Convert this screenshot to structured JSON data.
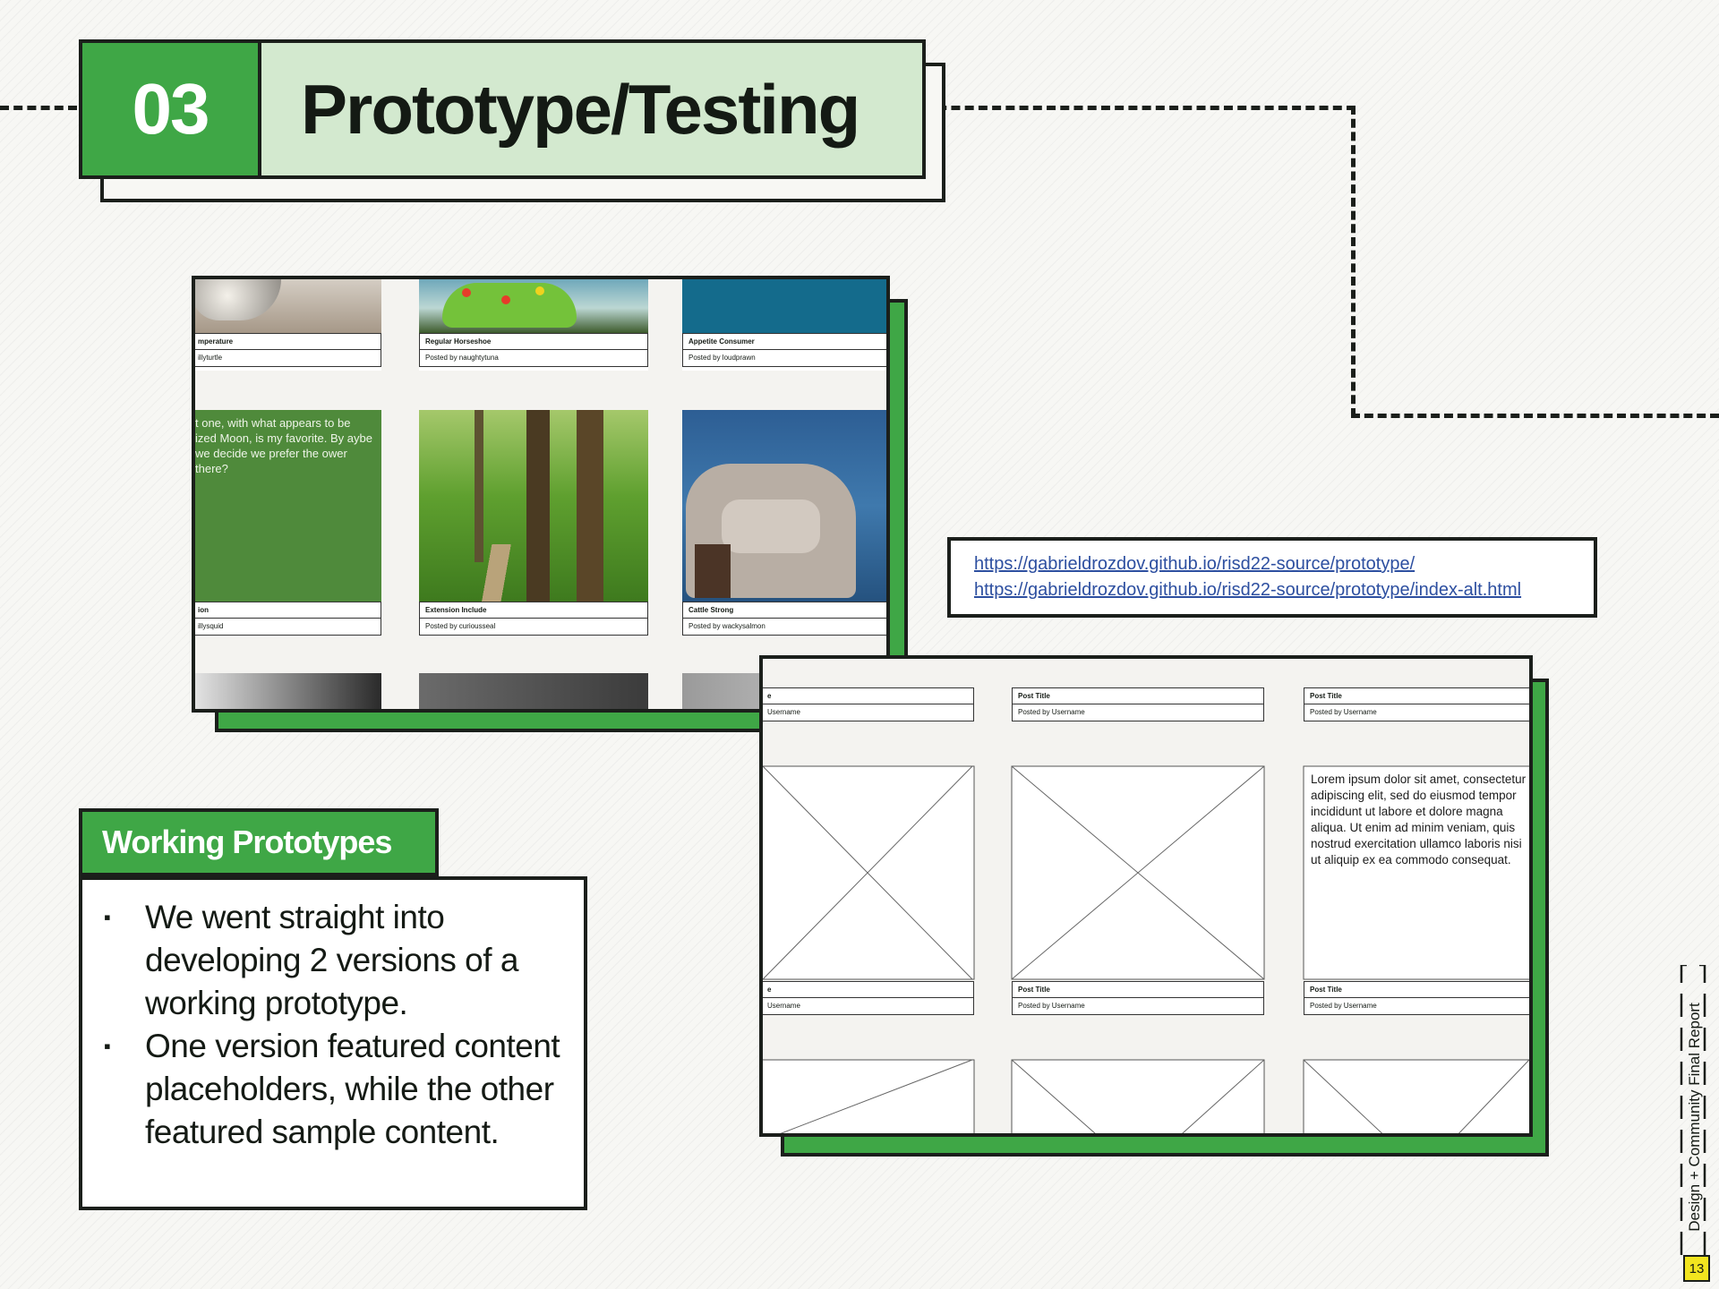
{
  "section": {
    "number": "03",
    "title": "Prototype/Testing"
  },
  "shot_a": {
    "cards": [
      {
        "title": "mperature",
        "byline": "illyturtle"
      },
      {
        "title": "Regular Horseshoe",
        "byline": "Posted by naughtytuna"
      },
      {
        "title": "Appetite Consumer",
        "byline": "Posted by loudprawn"
      },
      {
        "title": "ion",
        "byline": "illysquid"
      },
      {
        "title": "Extension Include",
        "byline": "Posted by curiousseal"
      },
      {
        "title": "Cattle Strong",
        "byline": "Posted by wackysalmon"
      }
    ],
    "quote": "t one, with what appears to be ized Moon, is my favorite. By aybe we decide we prefer the ower there?"
  },
  "links": [
    "https://gabrieldrozdov.github.io/risd22-source/prototype/",
    "https://gabrieldrozdov.github.io/risd22-source/prototype/index-alt.html"
  ],
  "shot_b": {
    "row1": [
      {
        "title": "e",
        "byline": "Username"
      },
      {
        "title": "Post Title",
        "byline": "Posted by Username"
      },
      {
        "title": "Post Title",
        "byline": "Posted by Username"
      }
    ],
    "row2": [
      {
        "title": "e",
        "byline": "Username"
      },
      {
        "title": "Post Title",
        "byline": "Posted by Username"
      },
      {
        "title": "Post Title",
        "byline": "Posted by Username"
      }
    ],
    "lorem": "Lorem ipsum dolor sit amet, consectetur adipiscing elit, sed do eiusmod tempor incididunt ut labore et dolore magna aliqua. Ut enim ad minim veniam, quis nostrud exercitation ullamco laboris nisi ut aliquip ex ea commodo consequat."
  },
  "working_prototypes": {
    "title": "Working Prototypes",
    "bullets": [
      "We went straight into developing 2 versions of a working prototype.",
      "One version featured content placeholders, while the other featured sample content."
    ]
  },
  "sidebar": {
    "label": "Design + Community Final Report",
    "page": "13"
  },
  "colors": {
    "green": "#3fa746",
    "light_green": "#d3e9cf",
    "ink": "#1b1f1b",
    "link": "#2d4fa0",
    "page_badge": "#f2e51f"
  }
}
